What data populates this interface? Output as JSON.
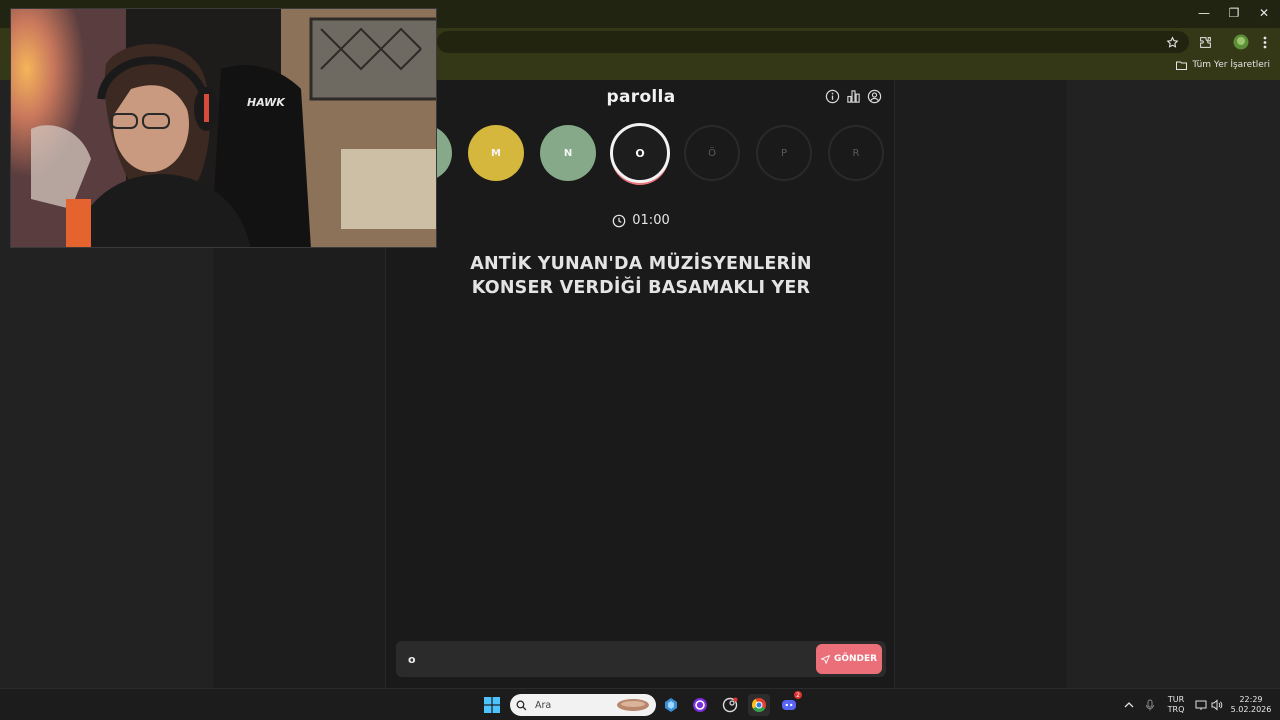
{
  "browser": {
    "bookmarks": {
      "all_bookmarks_label": "Tüm Yer İşaretleri"
    },
    "window_controls": [
      "minimize",
      "restore",
      "close"
    ],
    "toolbar_icons": [
      "star-icon",
      "extensions-icon",
      "profile-avatar",
      "menu-icon"
    ]
  },
  "app": {
    "title": "parolla",
    "header_icons": [
      "info-icon",
      "stats-icon",
      "user-icon"
    ],
    "letters": [
      {
        "letter": "",
        "state": "correct"
      },
      {
        "letter": "M",
        "state": "passed"
      },
      {
        "letter": "N",
        "state": "correct"
      },
      {
        "letter": "O",
        "state": "current"
      },
      {
        "letter": "Ö",
        "state": "pending"
      },
      {
        "letter": "P",
        "state": "pending"
      },
      {
        "letter": "R",
        "state": "pending"
      }
    ],
    "timer": "01:00",
    "question_line1": "ANTİK YUNAN'DA MÜZİSYENLERİN",
    "question_line2": "KONSER VERDİĞİ BASAMAKLI YER",
    "answer_value": "o",
    "send_label": "GÖNDER",
    "colors": {
      "correct": "#86a98a",
      "passed": "#d4b73c",
      "accent": "#ea6f78"
    }
  },
  "webcam": {
    "chair_brand": "HAWK"
  },
  "taskbar": {
    "search_label": "Ara",
    "language_line1": "TUR",
    "language_line2": "TRQ",
    "time": "22:29",
    "date": "5.02.2026",
    "discord_badge": "2"
  }
}
